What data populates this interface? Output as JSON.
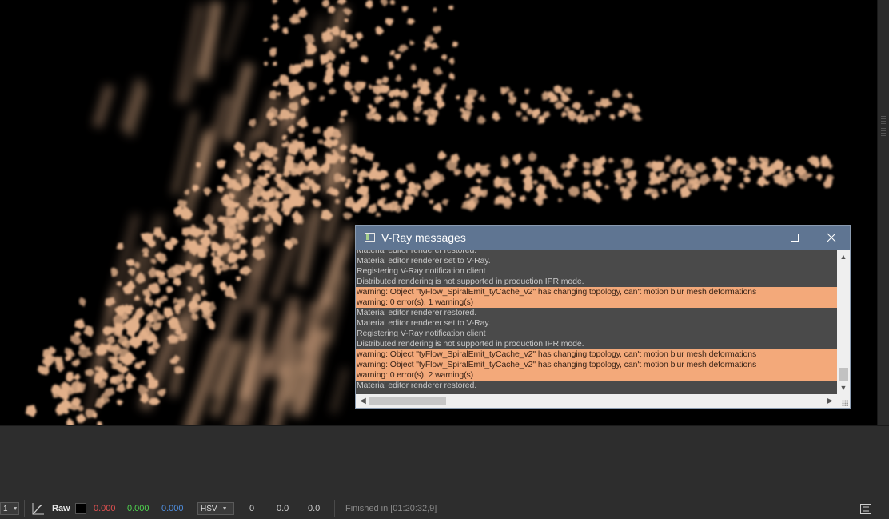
{
  "dialog": {
    "title": "V-Ray messages",
    "messages": [
      {
        "text": "Material editor renderer restored.",
        "level": "info"
      },
      {
        "text": "Material editor renderer set to V-Ray.",
        "level": "info"
      },
      {
        "text": "Registering V-Ray notification client",
        "level": "info"
      },
      {
        "text": "Distributed rendering is not supported in production IPR mode.",
        "level": "info"
      },
      {
        "text": "warning: Object \"tyFlow_SpiralEmit_tyCache_v2\" has changing topology, can't motion blur mesh deformations",
        "level": "warning"
      },
      {
        "text": "warning: 0 error(s), 1 warning(s)",
        "level": "warning"
      },
      {
        "text": "Material editor renderer restored.",
        "level": "info"
      },
      {
        "text": "Material editor renderer set to V-Ray.",
        "level": "info"
      },
      {
        "text": "Registering V-Ray notification client",
        "level": "info"
      },
      {
        "text": "Distributed rendering is not supported in production IPR mode.",
        "level": "info"
      },
      {
        "text": "warning: Object \"tyFlow_SpiralEmit_tyCache_v2\" has changing topology, can't motion blur mesh deformations",
        "level": "warning"
      },
      {
        "text": "warning: Object \"tyFlow_SpiralEmit_tyCache_v2\" has changing topology, can't motion blur mesh deformations",
        "level": "warning"
      },
      {
        "text": "warning: 0 error(s), 2 warning(s)",
        "level": "warning"
      },
      {
        "text": "Material editor renderer restored.",
        "level": "info"
      }
    ],
    "warning_color": "#f3a97a"
  },
  "status": {
    "layer_value": "1",
    "curve_icon": "curve-icon",
    "raw_label": "Raw",
    "swatch_color": "#000000",
    "r": "0.000",
    "g": "0.000",
    "b": "0.000",
    "r_color": "#e05050",
    "g_color": "#4fd34f",
    "b_color": "#4f8fe0",
    "color_mode": "HSV",
    "h": "0",
    "s": "0.0",
    "v": "0.0",
    "finished_text": "Finished in [01:20:32,9]",
    "panel_icon": "panel-toggle-icon"
  },
  "render": {
    "particle_color": "#e2b08a"
  }
}
